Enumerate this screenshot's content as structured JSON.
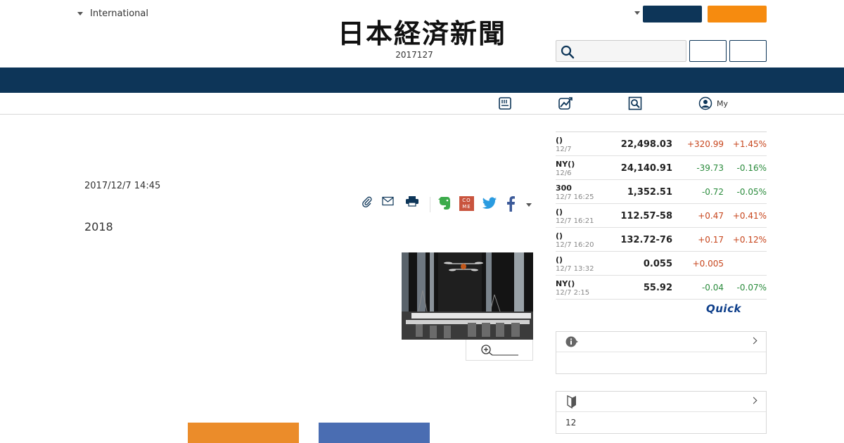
{
  "header": {
    "edition_label": "International",
    "logo_text": "日本経済新聞",
    "date_text": "2017127",
    "search": {
      "value": "",
      "placeholder": ""
    },
    "buttons": {
      "primary": "",
      "secondary": "",
      "outline_1": "",
      "outline_2": ""
    }
  },
  "subnav": {
    "items": [
      {
        "icon": "newspaper-icon",
        "label": ""
      },
      {
        "icon": "chart-icon",
        "label": ""
      },
      {
        "icon": "search-doc-icon",
        "label": ""
      },
      {
        "icon": "user-icon",
        "label": "My"
      }
    ]
  },
  "article": {
    "date": "2017/12/7 14:45",
    "title": "2018",
    "share_icons": [
      "clip-icon",
      "mail-icon",
      "print-icon",
      "evernote-icon",
      "comemo-icon",
      "twitter-icon",
      "facebook-icon",
      "more-caret-icon"
    ],
    "comemo_letters": "CO ME"
  },
  "market": {
    "rows": [
      {
        "name": "()",
        "time": "12/7",
        "value": "22,498.03",
        "change": "+320.99",
        "percent": "+1.45%",
        "dir": "up"
      },
      {
        "name": "NY()",
        "time": "12/6",
        "value": "24,140.91",
        "change": "-39.73",
        "percent": "-0.16%",
        "dir": "down"
      },
      {
        "name": "300",
        "time": "12/7 16:25",
        "value": "1,352.51",
        "change": "-0.72",
        "percent": "-0.05%",
        "dir": "down"
      },
      {
        "name": "()",
        "time": "12/7 16:21",
        "value": "112.57-58",
        "change": "+0.47",
        "percent": "+0.41%",
        "dir": "up"
      },
      {
        "name": "()",
        "time": "12/7 16:20",
        "value": "132.72-76",
        "change": "+0.17",
        "percent": "+0.12%",
        "dir": "up"
      },
      {
        "name": "()",
        "time": "12/7 13:32",
        "value": "0.055",
        "change": "+0.005",
        "percent": "",
        "dir": "up"
      },
      {
        "name": "NY()",
        "time": "12/7 2:15",
        "value": "55.92",
        "change": "-0.04",
        "percent": "-0.07%",
        "dir": "down"
      }
    ],
    "provider": "Quick"
  },
  "panels": [
    {
      "icon": "info-icon",
      "title": "",
      "body": ""
    },
    {
      "icon": "beginner-mark-icon",
      "title": "",
      "body": "12"
    }
  ],
  "colors": {
    "navy": "#0d3558",
    "orange": "#f68b0f",
    "up": "#c7451c",
    "down": "#2a8b3c",
    "share_orange": "#eb8c2a",
    "share_blue": "#4a6db2"
  }
}
